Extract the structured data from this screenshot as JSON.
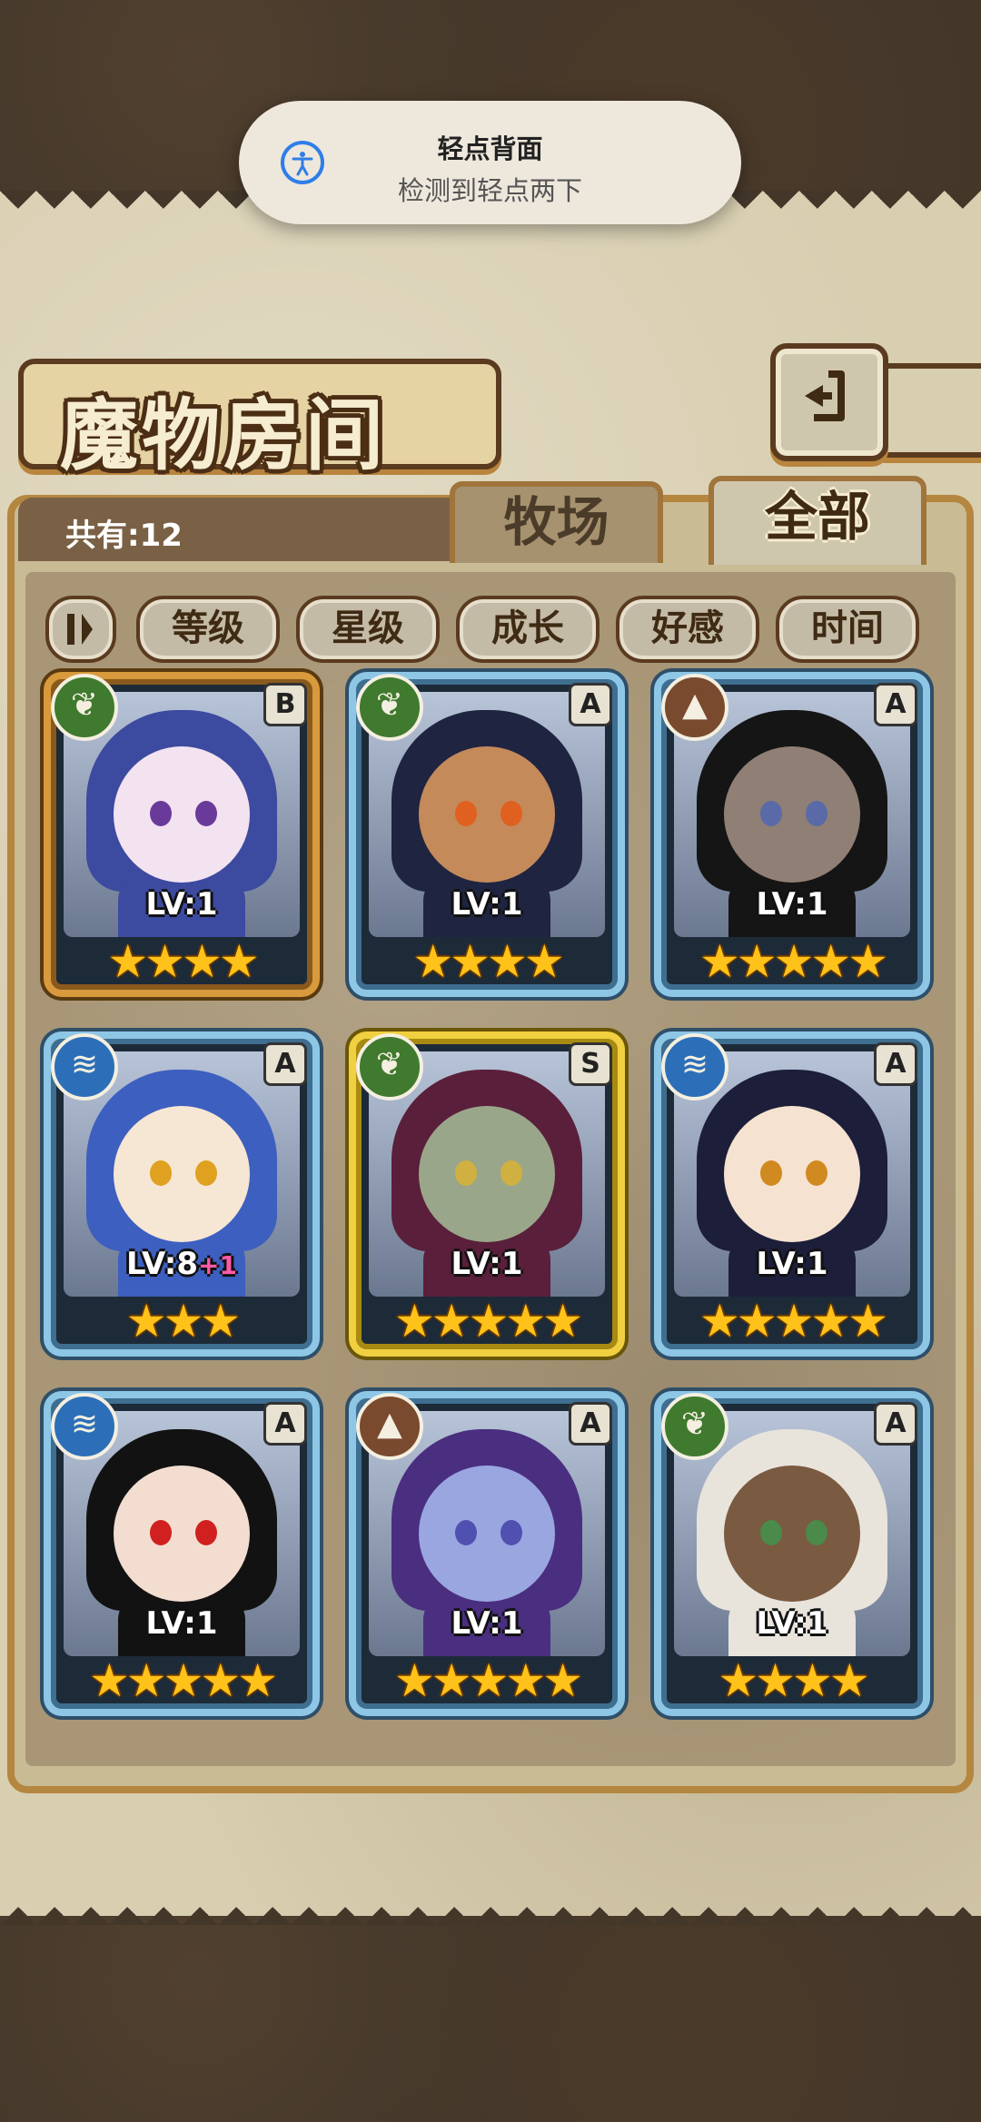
{
  "toast": {
    "title": "轻点背面",
    "subtitle": "检测到轻点两下",
    "icon": "accessibility-icon",
    "accent": "#2f7ee8"
  },
  "header": {
    "title": "魔物房间",
    "back_icon": "return-arrow-icon"
  },
  "collection": {
    "count_label": "共有:12",
    "tabs": [
      {
        "label": "牧场",
        "active": false
      },
      {
        "label": "全部",
        "active": true
      }
    ]
  },
  "filters": {
    "toggle_icon": "sort-toggle-icon",
    "buttons": [
      "等级",
      "星级",
      "成长",
      "好感",
      "时间"
    ]
  },
  "monsters": [
    {
      "element": "leaf",
      "rank": "B",
      "level": "LV:1",
      "bonus": "",
      "stars": "★★★★",
      "frame": "bronze",
      "hair": "#3c4aa0",
      "skin": "#f3e2f0",
      "eyes": "#6a3a9a"
    },
    {
      "element": "leaf",
      "rank": "A",
      "level": "LV:1",
      "bonus": "",
      "stars": "★★★★",
      "frame": "blue",
      "hair": "#1f2440",
      "skin": "#c48a5a",
      "eyes": "#e06020"
    },
    {
      "element": "earth",
      "rank": "A",
      "level": "LV:1",
      "bonus": "",
      "stars": "★★★★★",
      "frame": "blue",
      "hair": "#151515",
      "skin": "#8f7f74",
      "eyes": "#5a6aa8"
    },
    {
      "element": "water",
      "rank": "A",
      "level": "LV:8",
      "bonus": "+1",
      "stars": "★★★",
      "frame": "blue",
      "hair": "#3d5fbf",
      "skin": "#f6e6d4",
      "eyes": "#e0a020"
    },
    {
      "element": "leaf",
      "rank": "S",
      "level": "LV:1",
      "bonus": "",
      "stars": "★★★★★",
      "frame": "gold",
      "hair": "#5a1f3a",
      "skin": "#9aa68a",
      "eyes": "#d0b040"
    },
    {
      "element": "water",
      "rank": "A",
      "level": "LV:1",
      "bonus": "",
      "stars": "★★★★★",
      "frame": "blue",
      "hair": "#1c1e3a",
      "skin": "#f6e2d0",
      "eyes": "#d08a20"
    },
    {
      "element": "water",
      "rank": "A",
      "level": "LV:1",
      "bonus": "",
      "stars": "★★★★★",
      "frame": "blue",
      "hair": "#121212",
      "skin": "#f3ddd0",
      "eyes": "#d02020"
    },
    {
      "element": "earth",
      "rank": "A",
      "level": "LV:1",
      "bonus": "",
      "stars": "★★★★★",
      "frame": "blue",
      "hair": "#4a2e80",
      "skin": "#9aa6e0",
      "eyes": "#5050b0"
    },
    {
      "element": "leaf",
      "rank": "A",
      "level": "LV:1",
      "bonus": "",
      "stars": "★★★★",
      "frame": "blue",
      "hair": "#e8e4dc",
      "skin": "#7a5a40",
      "eyes": "#4a8a4a"
    }
  ]
}
